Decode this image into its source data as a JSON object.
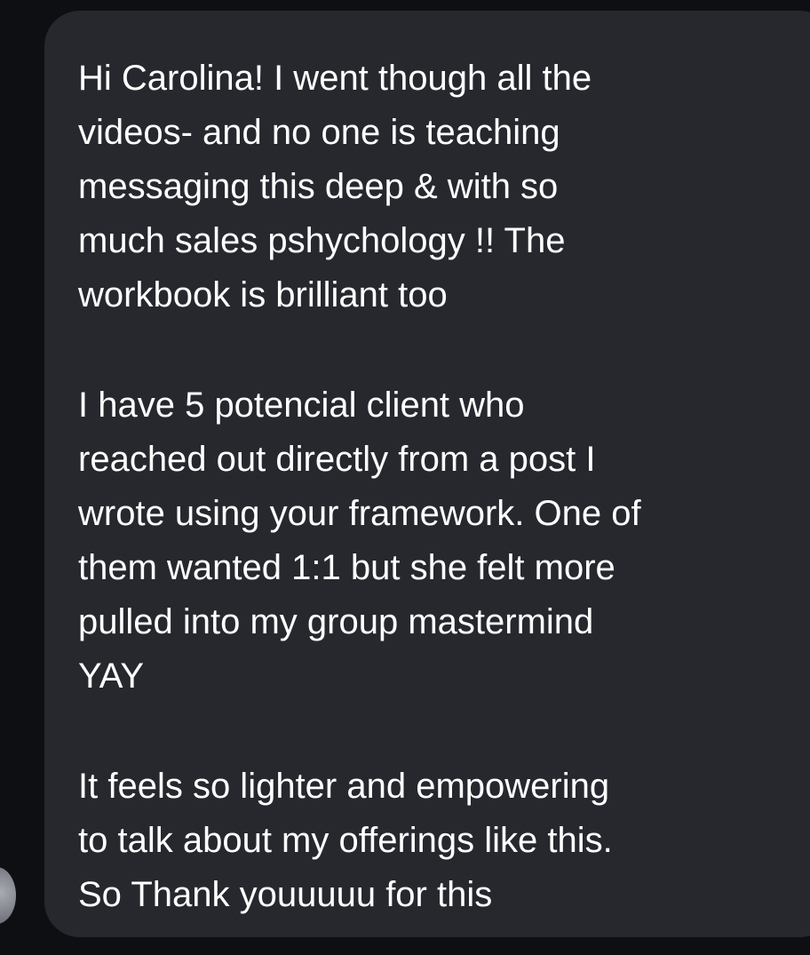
{
  "message": {
    "paragraphs": [
      {
        "lines": [
          "Hi Carolina! I went though all the",
          "videos- and no one is teaching",
          "messaging this deep & with so",
          "much sales pshychology !! The",
          "workbook is brilliant too"
        ]
      },
      {
        "lines": [
          "I have 5 potencial client who",
          "reached out directly from a post I",
          "wrote using your framework. One of",
          "them wanted 1:1 but she felt more",
          "pulled into my group mastermind",
          "YAY"
        ]
      },
      {
        "lines": [
          "It feels so lighter and empowering",
          "to talk about my offerings like this.",
          "So Thank youuuuu for this"
        ]
      }
    ]
  },
  "colors": {
    "background": "#0d0f13",
    "bubble": "#26282e",
    "text": "#ffffff"
  }
}
